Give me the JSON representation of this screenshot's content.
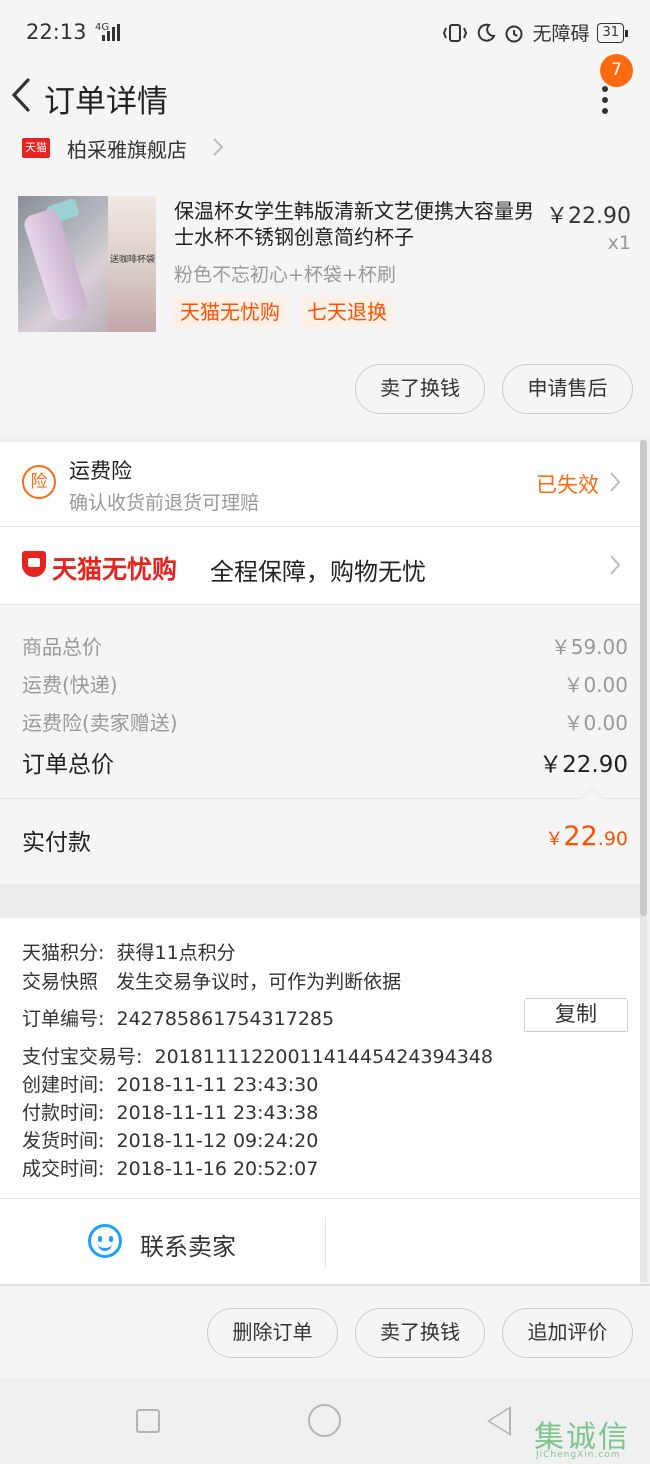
{
  "status_bar": {
    "time": "22:13",
    "network": "4G",
    "accessibility": "无障碍",
    "battery": "31"
  },
  "navbar": {
    "title": "订单详情",
    "badge": "7"
  },
  "store": {
    "logo": "天猫",
    "name": "柏采雅旗舰店"
  },
  "product": {
    "title": "保温杯女学生韩版清新文艺便携大容量男士水杯不锈钢创意简约杯子",
    "price": "￥22.90",
    "quantity": "x1",
    "sku": "粉色不忘初心+杯袋+杯刷",
    "tags": [
      "天猫无忧购",
      "七天退换"
    ],
    "image_text": "送咖啡杯袋",
    "buttons": [
      "卖了换钱",
      "申请售后"
    ]
  },
  "insurance": {
    "icon_label": "险",
    "title": "运费险",
    "subtitle": "确认收货前退货可理赔",
    "status": "已失效"
  },
  "worry_free": {
    "brand": "天猫无忧购",
    "slogan": "全程保障，购物无忧"
  },
  "summary": {
    "rows": [
      {
        "label": "商品总价",
        "value": "￥59.00"
      },
      {
        "label": "运费(快递)",
        "value": "￥0.00"
      },
      {
        "label": "运费险(卖家赠送)",
        "value": "￥0.00"
      }
    ],
    "total_label": "订单总价",
    "total_value": "￥22.90"
  },
  "paid": {
    "label": "实付款",
    "currency": "￥",
    "integer": "22",
    "decimal": ".90"
  },
  "details": {
    "points_label": "天猫积分:",
    "points_value": "获得11点积分",
    "snapshot_label": "交易快照",
    "snapshot_value": "发生交易争议时，可作为判断依据",
    "order_no_label": "订单编号:",
    "order_no_value": "242785861754317285",
    "copy_label": "复制",
    "alipay_label": "支付宝交易号:",
    "alipay_value": "2018111122001141445424394348",
    "times": [
      {
        "label": "创建时间:",
        "value": "2018-11-11 23:43:30"
      },
      {
        "label": "付款时间:",
        "value": "2018-11-11 23:43:38"
      },
      {
        "label": "发货时间:",
        "value": "2018-11-12 09:24:20"
      },
      {
        "label": "成交时间:",
        "value": "2018-11-16 20:52:07"
      }
    ]
  },
  "contact": {
    "label": "联系卖家"
  },
  "actions": {
    "delete": "删除订单",
    "sell": "卖了换钱",
    "review": "追加评价"
  },
  "watermark": {
    "chars": "集诚信",
    "url": "JiChengXin.com"
  },
  "colors": {
    "accent": "#ff5000",
    "tmall_red": "#e5231f",
    "contact_blue": "#1ea0ff"
  }
}
